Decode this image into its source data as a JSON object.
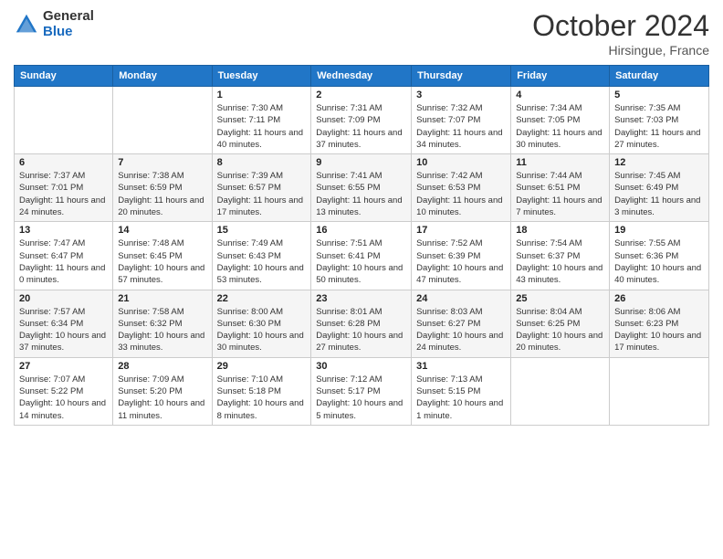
{
  "header": {
    "logo_general": "General",
    "logo_blue": "Blue",
    "month_title": "October 2024",
    "location": "Hirsingue, France"
  },
  "days_of_week": [
    "Sunday",
    "Monday",
    "Tuesday",
    "Wednesday",
    "Thursday",
    "Friday",
    "Saturday"
  ],
  "weeks": [
    [
      {
        "day": "",
        "info": ""
      },
      {
        "day": "",
        "info": ""
      },
      {
        "day": "1",
        "info": "Sunrise: 7:30 AM\nSunset: 7:11 PM\nDaylight: 11 hours and 40 minutes."
      },
      {
        "day": "2",
        "info": "Sunrise: 7:31 AM\nSunset: 7:09 PM\nDaylight: 11 hours and 37 minutes."
      },
      {
        "day": "3",
        "info": "Sunrise: 7:32 AM\nSunset: 7:07 PM\nDaylight: 11 hours and 34 minutes."
      },
      {
        "day": "4",
        "info": "Sunrise: 7:34 AM\nSunset: 7:05 PM\nDaylight: 11 hours and 30 minutes."
      },
      {
        "day": "5",
        "info": "Sunrise: 7:35 AM\nSunset: 7:03 PM\nDaylight: 11 hours and 27 minutes."
      }
    ],
    [
      {
        "day": "6",
        "info": "Sunrise: 7:37 AM\nSunset: 7:01 PM\nDaylight: 11 hours and 24 minutes."
      },
      {
        "day": "7",
        "info": "Sunrise: 7:38 AM\nSunset: 6:59 PM\nDaylight: 11 hours and 20 minutes."
      },
      {
        "day": "8",
        "info": "Sunrise: 7:39 AM\nSunset: 6:57 PM\nDaylight: 11 hours and 17 minutes."
      },
      {
        "day": "9",
        "info": "Sunrise: 7:41 AM\nSunset: 6:55 PM\nDaylight: 11 hours and 13 minutes."
      },
      {
        "day": "10",
        "info": "Sunrise: 7:42 AM\nSunset: 6:53 PM\nDaylight: 11 hours and 10 minutes."
      },
      {
        "day": "11",
        "info": "Sunrise: 7:44 AM\nSunset: 6:51 PM\nDaylight: 11 hours and 7 minutes."
      },
      {
        "day": "12",
        "info": "Sunrise: 7:45 AM\nSunset: 6:49 PM\nDaylight: 11 hours and 3 minutes."
      }
    ],
    [
      {
        "day": "13",
        "info": "Sunrise: 7:47 AM\nSunset: 6:47 PM\nDaylight: 11 hours and 0 minutes."
      },
      {
        "day": "14",
        "info": "Sunrise: 7:48 AM\nSunset: 6:45 PM\nDaylight: 10 hours and 57 minutes."
      },
      {
        "day": "15",
        "info": "Sunrise: 7:49 AM\nSunset: 6:43 PM\nDaylight: 10 hours and 53 minutes."
      },
      {
        "day": "16",
        "info": "Sunrise: 7:51 AM\nSunset: 6:41 PM\nDaylight: 10 hours and 50 minutes."
      },
      {
        "day": "17",
        "info": "Sunrise: 7:52 AM\nSunset: 6:39 PM\nDaylight: 10 hours and 47 minutes."
      },
      {
        "day": "18",
        "info": "Sunrise: 7:54 AM\nSunset: 6:37 PM\nDaylight: 10 hours and 43 minutes."
      },
      {
        "day": "19",
        "info": "Sunrise: 7:55 AM\nSunset: 6:36 PM\nDaylight: 10 hours and 40 minutes."
      }
    ],
    [
      {
        "day": "20",
        "info": "Sunrise: 7:57 AM\nSunset: 6:34 PM\nDaylight: 10 hours and 37 minutes."
      },
      {
        "day": "21",
        "info": "Sunrise: 7:58 AM\nSunset: 6:32 PM\nDaylight: 10 hours and 33 minutes."
      },
      {
        "day": "22",
        "info": "Sunrise: 8:00 AM\nSunset: 6:30 PM\nDaylight: 10 hours and 30 minutes."
      },
      {
        "day": "23",
        "info": "Sunrise: 8:01 AM\nSunset: 6:28 PM\nDaylight: 10 hours and 27 minutes."
      },
      {
        "day": "24",
        "info": "Sunrise: 8:03 AM\nSunset: 6:27 PM\nDaylight: 10 hours and 24 minutes."
      },
      {
        "day": "25",
        "info": "Sunrise: 8:04 AM\nSunset: 6:25 PM\nDaylight: 10 hours and 20 minutes."
      },
      {
        "day": "26",
        "info": "Sunrise: 8:06 AM\nSunset: 6:23 PM\nDaylight: 10 hours and 17 minutes."
      }
    ],
    [
      {
        "day": "27",
        "info": "Sunrise: 7:07 AM\nSunset: 5:22 PM\nDaylight: 10 hours and 14 minutes."
      },
      {
        "day": "28",
        "info": "Sunrise: 7:09 AM\nSunset: 5:20 PM\nDaylight: 10 hours and 11 minutes."
      },
      {
        "day": "29",
        "info": "Sunrise: 7:10 AM\nSunset: 5:18 PM\nDaylight: 10 hours and 8 minutes."
      },
      {
        "day": "30",
        "info": "Sunrise: 7:12 AM\nSunset: 5:17 PM\nDaylight: 10 hours and 5 minutes."
      },
      {
        "day": "31",
        "info": "Sunrise: 7:13 AM\nSunset: 5:15 PM\nDaylight: 10 hours and 1 minute."
      },
      {
        "day": "",
        "info": ""
      },
      {
        "day": "",
        "info": ""
      }
    ]
  ]
}
